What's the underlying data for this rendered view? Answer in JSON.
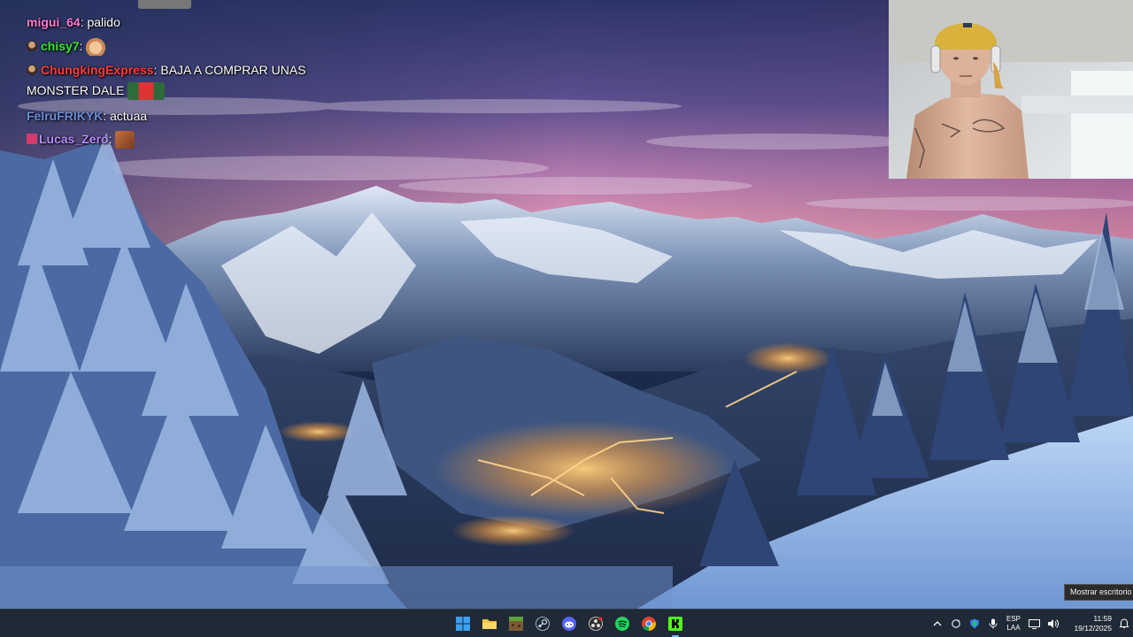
{
  "chat": {
    "messages": [
      {
        "user": "migui_64",
        "user_color": "#ff7ad6",
        "text": "palido"
      },
      {
        "user": "chisy7",
        "user_color": "#37e82f",
        "badge": "avatar-badge",
        "emote": "cat-emote"
      },
      {
        "user": "ChungkingExpress",
        "user_color": "#ff3b3b",
        "badge": "avatar-badge",
        "text": "BAJA A COMPRAR UNAS",
        "text2": "MONSTER DALE",
        "emote": "santa-emote"
      },
      {
        "user": "FelruFRIKYK",
        "user_color": "#6b8fd6",
        "text": "actuaa"
      },
      {
        "user": "Lucas_Zero",
        "user_color": "#b68cff",
        "badge": "sub-badge",
        "emote": "face-emote"
      }
    ]
  },
  "tooltip": {
    "text": "Mostrar escritorio"
  },
  "taskbar": {
    "apps": [
      {
        "name": "start-button",
        "icon": "windows-logo-icon"
      },
      {
        "name": "file-explorer",
        "icon": "folder-icon"
      },
      {
        "name": "minecraft",
        "icon": "minecraft-icon"
      },
      {
        "name": "steam",
        "icon": "steam-icon"
      },
      {
        "name": "discord",
        "icon": "discord-icon"
      },
      {
        "name": "obs",
        "icon": "obs-icon"
      },
      {
        "name": "spotify",
        "icon": "spotify-icon"
      },
      {
        "name": "chrome",
        "icon": "chrome-icon"
      },
      {
        "name": "kick",
        "icon": "kick-icon",
        "active": true
      }
    ],
    "tray": {
      "language_line1": "ESP",
      "language_line2": "LAA",
      "time": "11:59",
      "date": "19/12/2025"
    }
  },
  "colors": {
    "taskbar": "#1f2a36",
    "accent": "#7fb2ff",
    "kick": "#53fc18"
  }
}
